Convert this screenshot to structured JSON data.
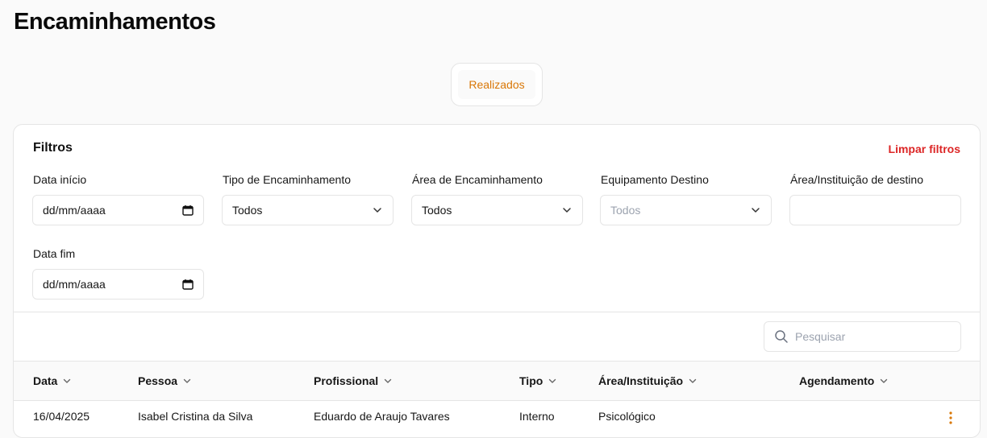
{
  "page": {
    "title": "Encaminhamentos"
  },
  "tabs": [
    {
      "label": "Realizados",
      "active": true
    }
  ],
  "filters": {
    "title": "Filtros",
    "clear_label": "Limpar filtros",
    "data_inicio": {
      "label": "Data início",
      "value": "dd/mm/aaaa"
    },
    "tipo": {
      "label": "Tipo de Encaminhamento",
      "value": "Todos"
    },
    "area": {
      "label": "Área de Encaminhamento",
      "value": "Todos"
    },
    "equipamento": {
      "label": "Equipamento Destino",
      "value": "Todos"
    },
    "instituicao": {
      "label": "Área/Instituição de destino",
      "value": ""
    },
    "data_fim": {
      "label": "Data fim",
      "value": "dd/mm/aaaa"
    }
  },
  "search": {
    "placeholder": "Pesquisar"
  },
  "table": {
    "columns": [
      "Data",
      "Pessoa",
      "Profissional",
      "Tipo",
      "Área/Instituição",
      "Agendamento"
    ],
    "rows": [
      {
        "data": "16/04/2025",
        "pessoa": "Isabel Cristina da Silva",
        "profissional": "Eduardo de Araujo Tavares",
        "tipo": "Interno",
        "area": "Psicológico",
        "agendamento": ""
      }
    ]
  },
  "colors": {
    "accent": "#d97706",
    "danger": "#dc2626",
    "border": "#e5e5e5"
  }
}
